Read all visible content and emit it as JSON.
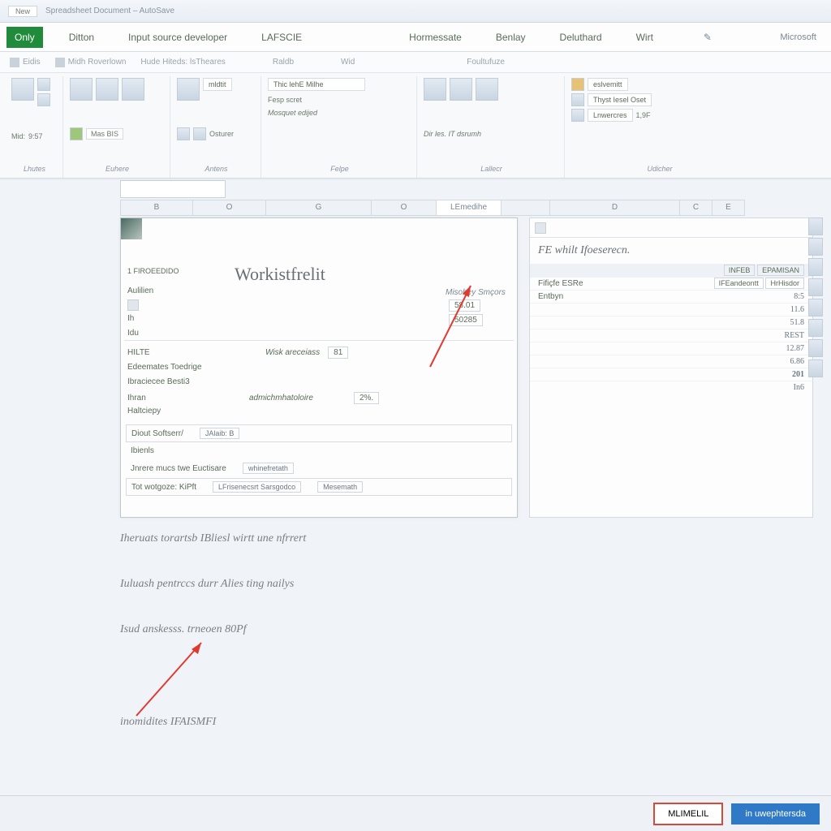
{
  "titlebar": {
    "left_btn": "New",
    "doc_info": "Spreadsheet Document – AutoSave"
  },
  "menubar": {
    "tabs": [
      "Only",
      "Ditton",
      "Input source developer",
      "LAFSCIE",
      "Hormessate",
      "Benlay",
      "Deluthard",
      "Wirt"
    ],
    "right": "Microsoft",
    "active_index": 0
  },
  "subbar": {
    "items": [
      "Eidis",
      "Midh  Roverlown",
      "Hude Hiteds: lsTheares",
      "Raldb",
      "Wid",
      "Foultufuze"
    ]
  },
  "ribbon": {
    "groups": [
      {
        "label": "Lhutes",
        "tags": [
          "Mid:",
          "9:57"
        ]
      },
      {
        "label": "Euhere",
        "tags": [
          "Mas BIS"
        ]
      },
      {
        "label": "Antens",
        "btn": "mldtit",
        "tags": [
          "Osturer"
        ]
      },
      {
        "label": "Felpe",
        "btn1": "Thic  lehE  Milhe",
        "btn2": "Fesp scret",
        "sub": "Mosquet edijed"
      },
      {
        "label": "Lallecr",
        "sub": "Dir les. IT dsrumh"
      },
      {
        "label": "Udicher",
        "row1": "eslvemitt",
        "row2": "Thyst Iesel Oset",
        "row3": "Lnwercres",
        "sub": "1,9F"
      }
    ]
  },
  "columns": [
    "",
    "B",
    "O",
    "G",
    "",
    "O",
    "",
    "D",
    "C",
    "E"
  ],
  "sheet_tabs": {
    "main": "LEmedihe"
  },
  "panel": {
    "title_label": "1 FIROEEDIDO",
    "title": "Workistfrelit",
    "subhead": "Misobey  Smçors",
    "rows": [
      {
        "label": "Aulilien",
        "val": ""
      },
      {
        "label": "Ih",
        "val": "58.01"
      },
      {
        "label": "Idu",
        "val": "50285"
      },
      {
        "label": "HILTE",
        "mid": "Wisk areceiass",
        "tag": "81"
      },
      {
        "label": "Edeemates Toedrige"
      },
      {
        "label": "Ibraciecee Besti3"
      },
      {
        "label": "Ihran",
        "mid": "admichmhatoloire",
        "tag": "2%."
      },
      {
        "label": "Haltciepy"
      }
    ],
    "bottom": [
      {
        "a": "Diout Softserr/",
        "b": "JAlaib: B"
      },
      {
        "a": "Ibienls"
      },
      {
        "a": "Jnrere mucs twe Euctisare",
        "b": "whinefretath"
      },
      {
        "a": "Tot wotgoze: KiPft",
        "b": "LFrisenecsrt Sarsgodco",
        "c": "Mesemath"
      }
    ]
  },
  "right_panel": {
    "title": "FE whilt Ifoeserecn.",
    "hdr_cols": [
      "INFEB",
      "EPAMISAN"
    ],
    "sub_cols": [
      "IFEandeontt",
      "HrHisdor"
    ],
    "lead": "Fifiçfe  ESRe",
    "rows": [
      {
        "a": "Entbyn",
        "v": "8:5"
      },
      {
        "a": "",
        "v": "11.6"
      },
      {
        "a": "",
        "v": "51.8"
      },
      {
        "a": "",
        "v": "REST"
      },
      {
        "a": "",
        "v": "12.87"
      },
      {
        "a": "",
        "v": "6.86"
      },
      {
        "a": "",
        "v": "201"
      },
      {
        "a": "",
        "v": "In6"
      }
    ]
  },
  "captions": {
    "c1": "Iheruats torartsb IBliesl wirtt une nfrrert",
    "c2": "Iuluash pentrccs durr Alies ting nailys",
    "c3": "Isud anskesss. trneoen 80Pf",
    "c4": "inomidites IFAISMFI"
  },
  "footer": {
    "cancel": "MLIMELIL",
    "ok": "in uwephtersda"
  }
}
